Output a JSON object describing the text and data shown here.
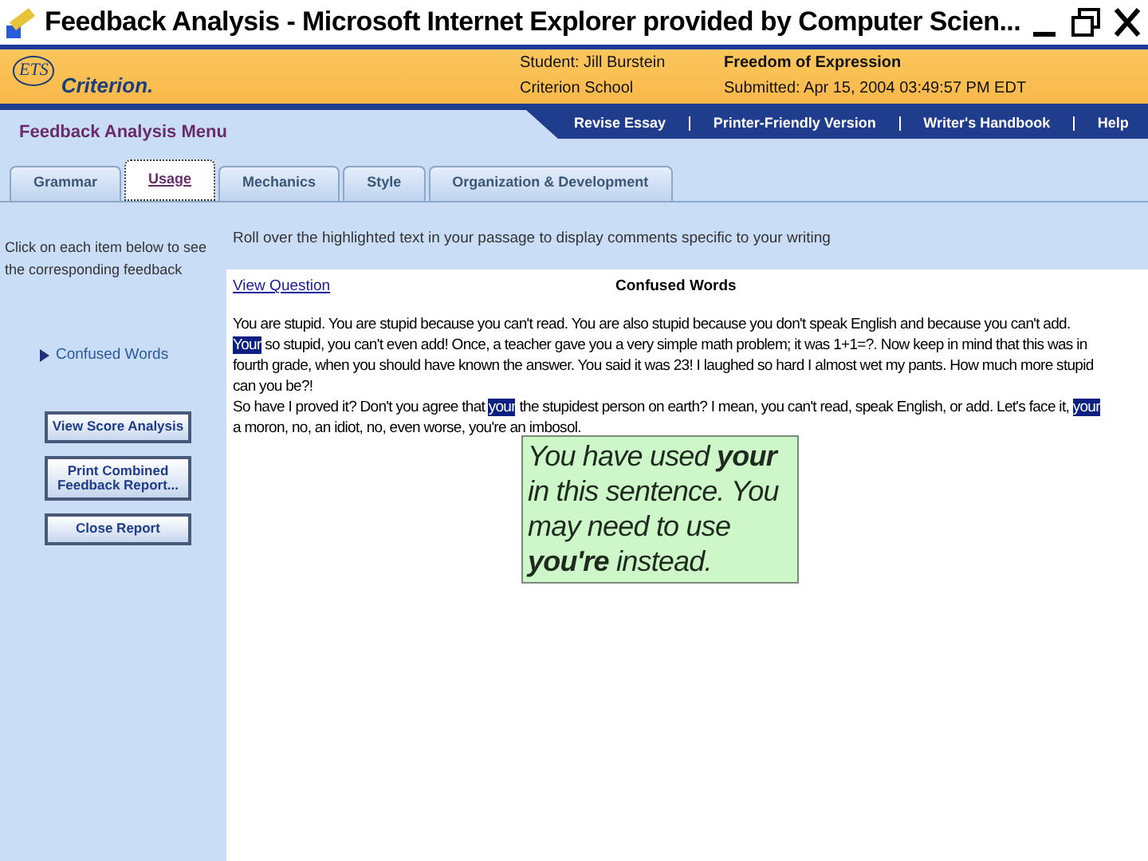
{
  "window": {
    "title": "Feedback Analysis - Microsoft Internet Explorer provided by Computer Scien..."
  },
  "header": {
    "logo_mark": "ETS",
    "logo_name": "Criterion.",
    "student": "Student: Jill Burstein",
    "school": "Criterion School",
    "prompt": "Freedom of Expression",
    "submitted": "Submitted: Apr 15, 2004 03:49:57 PM EDT"
  },
  "menu_title": "Feedback Analysis Menu",
  "nav_links": [
    "Revise Essay",
    "Printer-Friendly Version",
    "Writer's Handbook",
    "Help"
  ],
  "tabs": [
    {
      "label": "Grammar",
      "selected": false
    },
    {
      "label": "Usage",
      "selected": true
    },
    {
      "label": "Mechanics",
      "selected": false
    },
    {
      "label": "Style",
      "selected": false
    },
    {
      "label": "Organization & Development",
      "selected": false
    }
  ],
  "sidebar": {
    "instruction": "Click on each item below to see the corresponding feedback",
    "items": [
      {
        "label": "Confused Words"
      }
    ],
    "buttons": [
      "View Score Analysis",
      "Print Combined Feedback Report...",
      "Close Report"
    ]
  },
  "main": {
    "instruction": "Roll over the highlighted text in your passage to display comments specific to your writing",
    "view_question": "View Question",
    "section_title": "Confused Words",
    "essay": [
      [
        {
          "text": "You are stupid. You are stupid because you can't read. You are also stupid because you don't speak English and because you can't add. ",
          "highlighted": false
        },
        {
          "text": "Your",
          "highlighted": true
        },
        {
          "text": " so stupid, you can't even add! Once, a teacher gave you a very simple math problem; it was 1+1=?. Now keep in mind that this was in fourth grade, when you should have known the answer. You said it was 23! I laughed so hard I almost wet my pants. How much more stupid can you be?!",
          "highlighted": false
        }
      ],
      [
        {
          "text": "So have I proved it? Don't you agree that ",
          "highlighted": false
        },
        {
          "text": "your",
          "highlighted": true
        },
        {
          "text": " the stupidest person on earth? I mean, you can't read, speak English, or add. Let's face it, ",
          "highlighted": false
        },
        {
          "text": "your",
          "highlighted": true
        },
        {
          "text": " a moron, no, an idiot, no, even worse, you're an imbosol.",
          "highlighted": false
        }
      ]
    ],
    "tooltip": "You have used **your** in this sentence. You may need to use **you're** instead."
  }
}
